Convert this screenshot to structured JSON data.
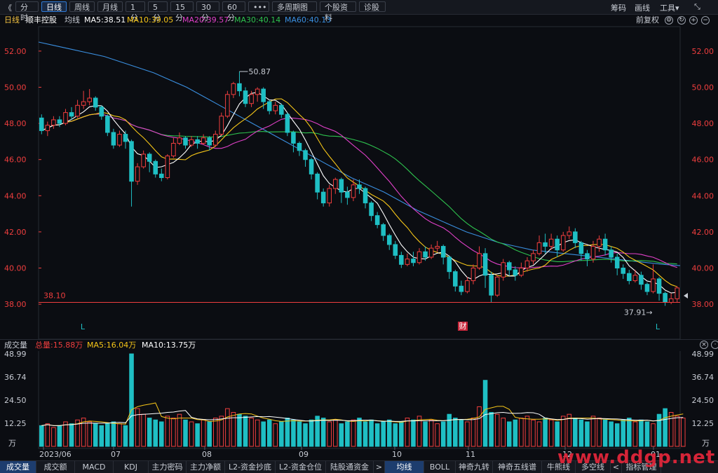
{
  "toolbar": {
    "back": "《",
    "items": [
      "分时",
      "日线",
      "周线",
      "月线",
      "1分",
      "5分",
      "15分",
      "30分",
      "60分",
      "•••",
      "多周期图",
      "个股资料",
      "诊股"
    ],
    "active": "日线",
    "right": [
      "筹码",
      "画线",
      "工具▾"
    ],
    "expand": "⤡"
  },
  "info": {
    "period": "日线",
    "stock_name": "顺丰控股",
    "ma_label": "均线",
    "ma5": "MA5:38.51",
    "ma10": "MA10:39.05",
    "ma20": "MA20:39.57",
    "ma30": "MA30:40.14",
    "ma60": "MA60:40.13",
    "adjust": "前复权",
    "colors": {
      "ma5": "#ffffff",
      "ma10": "#f5c518",
      "ma20": "#e040c8",
      "ma30": "#2ec24e",
      "ma60": "#3a8fe0",
      "up": "#f03e3e",
      "down": "#1fbfc4"
    }
  },
  "price_axis": {
    "ticks": [
      "52.00",
      "50.00",
      "48.00",
      "46.00",
      "44.00",
      "42.00",
      "40.00",
      "38.00"
    ],
    "high_label": "50.87",
    "low_label": "37.91",
    "line_label": "38.10",
    "markers": [
      "L",
      "财",
      "L"
    ]
  },
  "volume": {
    "title": "成交量",
    "total": "总量:15.88万",
    "ma5": "MA5:16.04万",
    "ma10": "MA10:13.75万",
    "ticks": [
      "48.99",
      "36.74",
      "24.50",
      "12.25",
      "万"
    ]
  },
  "dates": [
    "2023/06",
    "07",
    "08",
    "09",
    "10",
    "11",
    "12",
    "01"
  ],
  "bottom_tabs": [
    "成交量",
    "成交额",
    "MACD",
    "KDJ",
    "主力密码",
    "主力净额",
    "L2-资金抄底",
    "L2-资金仓位",
    "陆股通资金",
    ">",
    "均线",
    "BOLL",
    "神奇九转",
    "神奇五线谱",
    "牛熊线",
    "多空线",
    "<",
    "指标管理"
  ],
  "watermark": "www.ddgp.net",
  "chart_data": {
    "type": "candlestick",
    "title": "顺丰控股 日线",
    "ylim": [
      37.5,
      52.5
    ],
    "vol_ylim": [
      0,
      49
    ],
    "ohlc": [
      [
        48.3,
        47.6,
        48.5,
        47.4
      ],
      [
        47.6,
        47.9,
        48.1,
        47.3
      ],
      [
        47.9,
        48.2,
        48.4,
        47.7
      ],
      [
        48.2,
        48.0,
        48.4,
        47.8
      ],
      [
        48.0,
        48.6,
        48.8,
        47.9
      ],
      [
        48.6,
        48.4,
        48.9,
        48.2
      ],
      [
        48.4,
        49.0,
        49.3,
        48.3
      ],
      [
        49.0,
        49.2,
        49.8,
        48.8
      ],
      [
        49.2,
        49.4,
        49.9,
        49.0
      ],
      [
        49.4,
        48.9,
        49.5,
        48.7
      ],
      [
        48.9,
        48.4,
        49.0,
        48.2
      ],
      [
        48.4,
        47.5,
        48.5,
        47.3
      ],
      [
        47.5,
        46.8,
        47.7,
        46.6
      ],
      [
        46.8,
        47.4,
        47.6,
        46.7
      ],
      [
        47.4,
        47.0,
        47.6,
        46.6
      ],
      [
        47.0,
        44.8,
        47.1,
        43.4
      ],
      [
        44.8,
        45.6,
        45.8,
        44.6
      ],
      [
        45.6,
        46.3,
        46.5,
        45.5
      ],
      [
        46.3,
        45.9,
        46.4,
        45.3
      ],
      [
        45.9,
        45.2,
        46.0,
        45.0
      ],
      [
        45.2,
        45.0,
        45.5,
        44.8
      ],
      [
        45.0,
        46.2,
        46.3,
        44.9
      ],
      [
        46.2,
        46.9,
        47.2,
        46.1
      ],
      [
        46.9,
        47.2,
        47.5,
        46.8
      ],
      [
        47.2,
        46.8,
        47.3,
        46.6
      ],
      [
        46.8,
        47.1,
        47.3,
        46.7
      ],
      [
        47.1,
        46.9,
        47.3,
        46.6
      ],
      [
        46.9,
        47.2,
        47.4,
        46.8
      ],
      [
        47.2,
        46.8,
        47.3,
        46.5
      ],
      [
        46.8,
        47.4,
        47.6,
        46.7
      ],
      [
        47.4,
        48.4,
        48.6,
        47.3
      ],
      [
        48.4,
        49.6,
        49.8,
        48.3
      ],
      [
        49.6,
        50.2,
        50.3,
        49.4
      ],
      [
        50.2,
        49.8,
        50.87,
        49.5
      ],
      [
        49.8,
        49.1,
        50.0,
        48.9
      ],
      [
        49.1,
        49.6,
        49.8,
        48.9
      ],
      [
        49.6,
        49.9,
        50.0,
        49.2
      ],
      [
        49.9,
        49.2,
        50.0,
        48.8
      ],
      [
        49.2,
        48.7,
        49.3,
        48.5
      ],
      [
        48.7,
        49.0,
        49.2,
        48.5
      ],
      [
        49.0,
        48.5,
        49.1,
        48.3
      ],
      [
        48.5,
        47.5,
        48.6,
        47.3
      ],
      [
        47.5,
        46.9,
        47.6,
        46.4
      ],
      [
        46.9,
        46.5,
        47.0,
        46.2
      ],
      [
        46.5,
        46.0,
        46.6,
        45.6
      ],
      [
        46.0,
        45.2,
        46.1,
        44.9
      ],
      [
        45.2,
        44.2,
        45.3,
        43.8
      ],
      [
        44.2,
        43.6,
        44.4,
        43.4
      ],
      [
        43.6,
        44.4,
        44.6,
        43.4
      ],
      [
        44.4,
        44.9,
        45.0,
        44.1
      ],
      [
        44.9,
        44.2,
        45.0,
        43.6
      ],
      [
        44.2,
        43.9,
        44.5,
        43.5
      ],
      [
        43.9,
        44.6,
        44.9,
        43.7
      ],
      [
        44.6,
        44.4,
        44.9,
        44.1
      ],
      [
        44.4,
        43.6,
        44.5,
        43.3
      ],
      [
        43.6,
        42.9,
        43.7,
        42.6
      ],
      [
        42.9,
        42.4,
        43.1,
        42.2
      ],
      [
        42.4,
        41.8,
        42.5,
        41.5
      ],
      [
        41.8,
        41.3,
        41.9,
        41.0
      ],
      [
        41.3,
        40.7,
        41.5,
        40.5
      ],
      [
        40.7,
        40.2,
        40.9,
        40.0
      ],
      [
        40.2,
        40.5,
        40.8,
        40.1
      ],
      [
        40.5,
        40.3,
        40.9,
        40.1
      ],
      [
        40.3,
        40.9,
        41.1,
        40.2
      ],
      [
        40.9,
        40.6,
        41.2,
        40.4
      ],
      [
        40.6,
        41.1,
        41.3,
        40.5
      ],
      [
        41.1,
        41.2,
        41.5,
        40.9
      ],
      [
        41.2,
        40.6,
        41.3,
        40.2
      ],
      [
        40.6,
        39.8,
        40.7,
        39.4
      ],
      [
        39.8,
        39.0,
        39.9,
        38.7
      ],
      [
        39.0,
        38.7,
        39.3,
        38.5
      ],
      [
        38.7,
        39.3,
        39.5,
        38.6
      ],
      [
        39.3,
        40.0,
        40.2,
        39.1
      ],
      [
        40.0,
        40.8,
        41.2,
        39.9
      ],
      [
        40.8,
        39.6,
        41.1,
        38.9
      ],
      [
        39.6,
        38.5,
        39.8,
        38.1
      ],
      [
        38.5,
        39.5,
        39.6,
        38.4
      ],
      [
        39.5,
        40.3,
        40.5,
        39.3
      ],
      [
        40.3,
        39.9,
        40.4,
        39.6
      ],
      [
        39.9,
        39.6,
        40.1,
        39.3
      ],
      [
        39.6,
        40.0,
        40.3,
        39.5
      ],
      [
        40.0,
        40.4,
        40.6,
        39.8
      ],
      [
        40.4,
        40.8,
        41.0,
        40.2
      ],
      [
        40.8,
        41.4,
        41.8,
        40.7
      ],
      [
        41.4,
        41.2,
        41.9,
        40.8
      ],
      [
        41.2,
        41.6,
        41.9,
        41.0
      ],
      [
        41.6,
        41.0,
        41.8,
        40.6
      ],
      [
        41.0,
        41.8,
        42.0,
        40.9
      ],
      [
        41.8,
        42.0,
        42.3,
        41.6
      ],
      [
        42.0,
        41.4,
        42.2,
        41.1
      ],
      [
        41.4,
        40.8,
        41.5,
        40.4
      ],
      [
        40.8,
        40.5,
        41.0,
        40.1
      ],
      [
        40.5,
        41.2,
        41.5,
        40.3
      ],
      [
        41.2,
        41.6,
        41.8,
        40.9
      ],
      [
        41.6,
        41.0,
        41.9,
        40.7
      ],
      [
        41.0,
        40.6,
        41.2,
        40.3
      ],
      [
        40.6,
        40.0,
        40.8,
        39.6
      ],
      [
        40.0,
        39.7,
        40.2,
        39.4
      ],
      [
        39.7,
        39.3,
        39.9,
        39.1
      ],
      [
        39.3,
        39.6,
        39.9,
        39.2
      ],
      [
        39.6,
        39.1,
        39.8,
        38.8
      ],
      [
        39.1,
        38.7,
        39.2,
        38.5
      ],
      [
        38.7,
        39.4,
        40.2,
        38.6
      ],
      [
        39.4,
        38.6,
        39.5,
        38.2
      ],
      [
        38.6,
        38.1,
        38.7,
        37.91
      ],
      [
        38.1,
        38.3,
        38.6,
        38.0
      ],
      [
        38.3,
        38.9,
        39.0,
        38.1
      ]
    ],
    "volume": [
      11,
      12,
      10,
      11,
      13,
      12,
      14,
      15,
      13,
      12,
      11,
      12,
      13,
      12,
      11,
      49,
      20,
      17,
      15,
      14,
      13,
      16,
      15,
      17,
      14,
      13,
      12,
      14,
      13,
      15,
      16,
      20,
      18,
      17,
      16,
      15,
      14,
      13,
      14,
      12,
      13,
      15,
      14,
      13,
      12,
      14,
      16,
      15,
      13,
      14,
      12,
      13,
      14,
      15,
      13,
      14,
      12,
      13,
      14,
      12,
      13,
      15,
      14,
      16,
      13,
      14,
      12,
      13,
      17,
      15,
      14,
      13,
      15,
      21,
      35,
      18,
      17,
      15,
      13,
      14,
      15,
      16,
      14,
      13,
      15,
      14,
      13,
      16,
      17,
      15,
      14,
      13,
      16,
      15,
      14,
      13,
      12,
      14,
      15,
      13,
      14,
      13,
      12,
      17,
      20,
      18,
      16,
      15
    ],
    "ma60": [
      52.5,
      52.3,
      52.1,
      51.9,
      51.7,
      51.4,
      51.1,
      50.8,
      50.4,
      50.0,
      49.5,
      49.0,
      48.5,
      48.0,
      47.5,
      47.0,
      46.5,
      46.0,
      45.5,
      45.0,
      44.6,
      44.2,
      43.7,
      43.2,
      42.8,
      42.4,
      42.0,
      41.7,
      41.4,
      41.2,
      41.0,
      40.9,
      40.8,
      40.7,
      40.6,
      40.5,
      40.4,
      40.3,
      40.2,
      40.13
    ]
  }
}
